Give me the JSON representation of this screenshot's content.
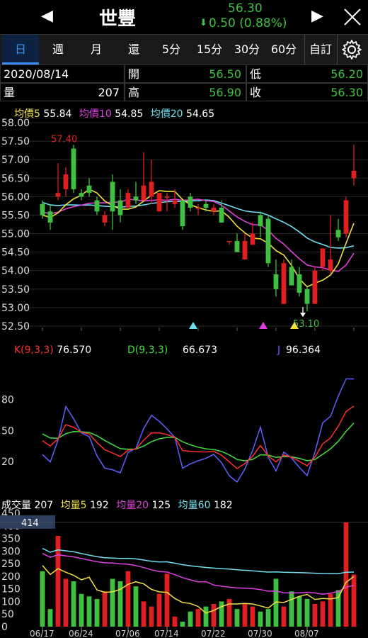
{
  "header": {
    "stock_name": "世豐",
    "price": "56.30",
    "change": "0.50 (0.88%)",
    "prev_label": "◀",
    "next_label": "▶",
    "close_icon": "close-icon",
    "change_arrow": "⬇"
  },
  "tabs": [
    "日",
    "週",
    "月",
    "還",
    "5分",
    "15分",
    "30分",
    "60分",
    "自訂"
  ],
  "settings_icon": "gear-icon",
  "info": {
    "date": "2020/08/14",
    "volume_label": "量",
    "volume": "207",
    "open_label": "開",
    "open": "56.50",
    "high_label": "高",
    "high": "56.90",
    "low_label": "低",
    "low": "56.20",
    "close_label": "收",
    "close": "56.30"
  },
  "ma_legend": [
    {
      "label": "均價5",
      "value": "55.84",
      "color": "#f0e040"
    },
    {
      "label": "均價10",
      "value": "54.85",
      "color": "#e040e0"
    },
    {
      "label": "均價20",
      "value": "54.65",
      "color": "#70e0f0"
    }
  ],
  "kd_legend": [
    {
      "label": "K(9,3,3)",
      "value": "76.570",
      "color": "#ff3030"
    },
    {
      "label": "D(9,3,3)",
      "value": "66.673",
      "color": "#40e040"
    },
    {
      "label": "J",
      "value": "96.364",
      "color": "#6060ff"
    }
  ],
  "vol_legend": [
    {
      "label": "成交量",
      "value": "207",
      "color": "#ffffff"
    },
    {
      "label": "均量5",
      "value": "192",
      "color": "#f0e040"
    },
    {
      "label": "均量20",
      "value": "125",
      "color": "#e040e0"
    },
    {
      "label": "均量60",
      "value": "182",
      "color": "#70e0f0"
    }
  ],
  "colors": {
    "up": "#e02020",
    "down": "#40c040",
    "ma5": "#f0e040",
    "ma10": "#e040e0",
    "ma20": "#70e0f0",
    "k": "#ff3030",
    "d": "#40e040",
    "j": "#6060ff"
  },
  "chart_data": [
    {
      "type": "candlestick",
      "x": [
        "06/17",
        "06/18",
        "06/19",
        "06/22",
        "06/23",
        "06/24",
        "06/29",
        "06/30",
        "07/01",
        "07/02",
        "07/03",
        "07/06",
        "07/07",
        "07/08",
        "07/09",
        "07/10",
        "07/13",
        "07/14",
        "07/15",
        "07/16",
        "07/17",
        "07/20",
        "07/21",
        "07/22",
        "07/23",
        "07/24",
        "07/27",
        "07/28",
        "07/29",
        "07/30",
        "07/31",
        "08/03",
        "08/04",
        "08/05",
        "08/06",
        "08/07",
        "08/10",
        "08/11",
        "08/12",
        "08/13",
        "08/14"
      ],
      "ohlc": [
        [
          55.8,
          55.9,
          55.4,
          55.5
        ],
        [
          55.6,
          55.8,
          55.1,
          55.3
        ],
        [
          56.0,
          56.9,
          55.9,
          56.1
        ],
        [
          56.2,
          56.8,
          56.0,
          56.6
        ],
        [
          57.3,
          57.4,
          56.1,
          56.2
        ],
        [
          56.1,
          56.2,
          55.9,
          56.0
        ],
        [
          56.3,
          56.5,
          56.0,
          56.1
        ],
        [
          55.9,
          56.0,
          55.5,
          55.6
        ],
        [
          55.3,
          55.6,
          55.2,
          55.5
        ],
        [
          56.4,
          56.6,
          55.1,
          55.6
        ],
        [
          55.9,
          56.2,
          55.3,
          55.5
        ],
        [
          55.7,
          56.2,
          55.7,
          56.1
        ],
        [
          56.0,
          56.4,
          55.8,
          55.9
        ],
        [
          55.9,
          57.2,
          55.9,
          56.3
        ],
        [
          56.0,
          57.0,
          55.8,
          56.4
        ],
        [
          55.6,
          56.1,
          55.6,
          56.1
        ],
        [
          56.0,
          56.1,
          55.6,
          56.0
        ],
        [
          55.8,
          56.2,
          55.7,
          55.9
        ],
        [
          55.9,
          55.9,
          55.1,
          55.2
        ],
        [
          56.0,
          56.1,
          55.6,
          55.7
        ],
        [
          55.7,
          55.8,
          55.5,
          55.7
        ],
        [
          55.8,
          55.9,
          55.6,
          55.7
        ],
        [
          55.6,
          55.8,
          55.5,
          55.7
        ],
        [
          55.7,
          55.9,
          55.3,
          55.3
        ],
        [
          54.8,
          54.8,
          54.7,
          54.8
        ],
        [
          54.8,
          55.0,
          54.5,
          54.5
        ],
        [
          54.3,
          55.0,
          54.3,
          54.8
        ],
        [
          54.7,
          55.3,
          54.7,
          55.0
        ],
        [
          55.5,
          55.6,
          54.9,
          55.2
        ],
        [
          55.4,
          55.5,
          54.1,
          54.2
        ],
        [
          53.9,
          54.3,
          53.3,
          53.5
        ],
        [
          53.1,
          54.3,
          53.1,
          54.2
        ],
        [
          54.1,
          54.3,
          53.6,
          53.6
        ],
        [
          53.9,
          54.1,
          53.3,
          53.4
        ],
        [
          53.5,
          53.6,
          52.9,
          53.1
        ],
        [
          53.1,
          54.1,
          53.1,
          54.0
        ],
        [
          54.1,
          54.6,
          54.0,
          54.6
        ],
        [
          54.0,
          55.5,
          53.9,
          54.3
        ],
        [
          55.1,
          55.4,
          54.8,
          54.9
        ],
        [
          55.0,
          56.0,
          54.9,
          55.9
        ],
        [
          56.5,
          57.4,
          56.3,
          56.7
        ]
      ],
      "ylim": [
        52.5,
        58.0
      ],
      "y_ticks": [
        "58.00",
        "57.50",
        "57.00",
        "56.50",
        "56.00",
        "55.50",
        "55.00",
        "54.50",
        "54.00",
        "53.50",
        "53.00",
        "52.50"
      ],
      "annotations": [
        {
          "text": "57.40",
          "color": "#e02020"
        },
        {
          "text": "53.10",
          "color": "#40c040"
        }
      ]
    },
    {
      "type": "line",
      "series": [
        {
          "name": "K(9,3,3)"
        },
        {
          "name": "D(9,3,3)"
        },
        {
          "name": "J"
        }
      ],
      "y_ticks": [
        "80",
        "50",
        "20"
      ]
    },
    {
      "type": "bar",
      "y_ticks": [
        "450",
        "400",
        "350",
        "300",
        "250",
        "200",
        "150",
        "100",
        "50",
        "0"
      ],
      "ylim": [
        0,
        450
      ],
      "highlight_value": "414",
      "x_ticks": [
        "06/17",
        "06/24",
        "07/06",
        "07/14",
        "07/22",
        "07/30",
        "08/07"
      ],
      "volumes": [
        220,
        70,
        360,
        190,
        180,
        130,
        120,
        110,
        140,
        190,
        180,
        220,
        160,
        100,
        80,
        130,
        210,
        40,
        20,
        60,
        70,
        80,
        90,
        100,
        110,
        70,
        90,
        80,
        60,
        70,
        190,
        80,
        140,
        120,
        110,
        90,
        100,
        130,
        145,
        414,
        207
      ]
    }
  ]
}
